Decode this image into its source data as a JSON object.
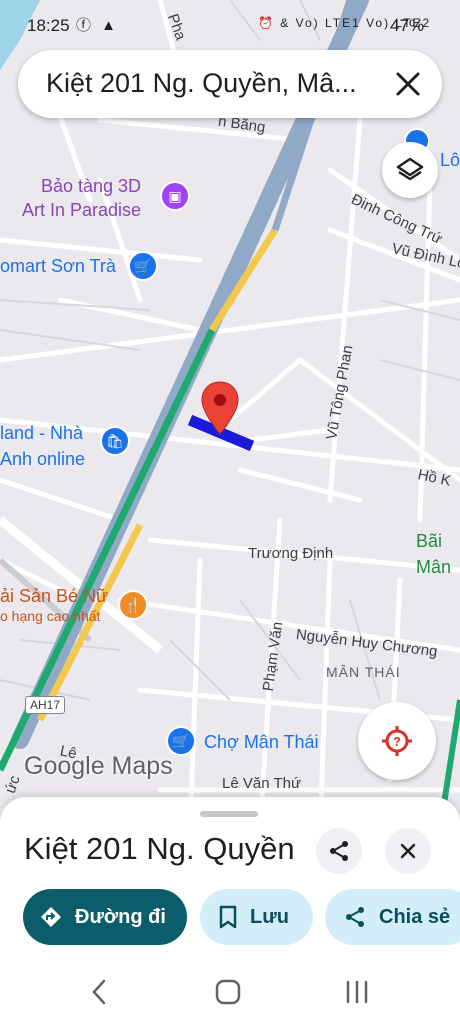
{
  "status_bar": {
    "time": "18:25",
    "left_icons": "ⓕ ▲",
    "right_icons": "⏰ & Vo) LTE1 Vo) LTE2",
    "battery": "47%"
  },
  "search": {
    "query": "Kiệt 201 Ng. Quyền, Mâ..."
  },
  "map": {
    "labels": {
      "museum": "Bảo tàng 3D\nArt In Paradise",
      "comart": "omart Sơn Trà",
      "shop": "land - Nhà\nAnh online",
      "seafood": "ải Sản Bé Nữ",
      "seafood_sub": "o hạng cao nhất",
      "market": "Chợ Mân Thái",
      "park": "Bãi\nMân",
      "street_truong_dinh": "Trương Định",
      "street_nhc": "Nguyễn Huy Chương",
      "street_vtp": "Vũ Tông Phan",
      "street_dct": "Đinh Công Trứ",
      "street_vdl": "Vũ Đình Lo",
      "street_ho": "Hồ K",
      "street_pv": "Phạm Văn",
      "street_lvt": "Lê Văn Thứ",
      "street_le": "Lê",
      "street_bang": "n Bằng",
      "street_pha": "Pha",
      "street_duc": "ức",
      "district": "MÂN THÁI",
      "highway_shield": "AH17",
      "top_right_poi": "Lô"
    },
    "watermark": "Google Maps",
    "colors": {
      "highway": "#8fa9c7",
      "route_green": "#1fa971",
      "route_yellow": "#f2c94c",
      "selected_road": "#1a1bd8",
      "pin": "#ea4335"
    }
  },
  "sheet": {
    "title": "Kiệt 201 Ng. Quyền",
    "directions_label": "Đường đi",
    "save_label": "Lưu",
    "share_label": "Chia sẻ"
  }
}
